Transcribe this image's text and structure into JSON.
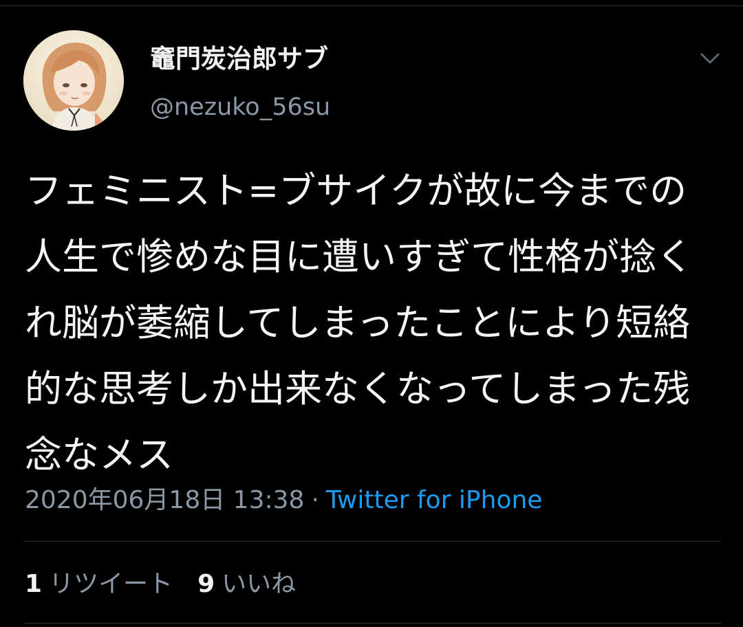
{
  "colors": {
    "background": "#000000",
    "text_primary": "#f5f5f5",
    "text_secondary": "#8b98a5",
    "link": "#1d9bf0",
    "divider": "#2f3336"
  },
  "author": {
    "display_name": "竈門炭治郎サブ",
    "handle": "@nezuko_56su",
    "avatar_icon": "avatar-illustration-girl"
  },
  "menu": {
    "icon": "chevron-down-icon"
  },
  "tweet": {
    "text": "フェミニスト=ブサイクが故に今までの人生で惨めな目に遭いすぎて性格が捻くれ脳が萎縮してしまったことにより短絡的な思考しか出来なくなってしまった残念なメス",
    "timestamp": "2020年06月18日 13:38",
    "separator": "·",
    "source": "Twitter for iPhone"
  },
  "stats": {
    "retweets": {
      "count": "1",
      "label": "リツイート"
    },
    "likes": {
      "count": "9",
      "label": "いいね"
    }
  }
}
